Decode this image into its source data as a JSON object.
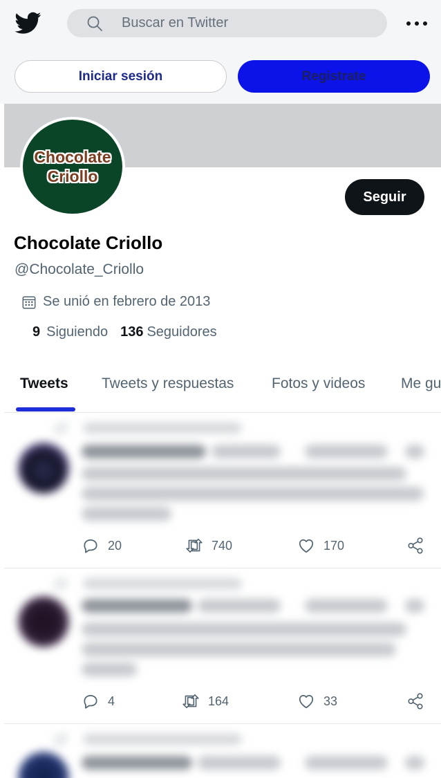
{
  "header": {
    "search_placeholder": "Buscar en Twitter",
    "login_label": "Iniciar sesión",
    "register_label": "Registrate"
  },
  "profile": {
    "avatar_text_line1": "Chocolate",
    "avatar_text_line2": "Criollo",
    "follow_label": "Seguir",
    "name": "Chocolate Criollo",
    "handle": "@Chocolate_Criollo",
    "joined": "Se unió en febrero de 2013",
    "following_count": "9",
    "following_label": "Siguiendo",
    "followers_count": "136",
    "followers_label": "Seguidores"
  },
  "tabs": [
    {
      "label": "Tweets"
    },
    {
      "label": "Tweets y respuestas"
    },
    {
      "label": "Fotos y videos"
    },
    {
      "label": "Me gu"
    }
  ],
  "tweets": [
    {
      "replies": "20",
      "retweets": "740",
      "likes": "170"
    },
    {
      "replies": "4",
      "retweets": "164",
      "likes": "33"
    },
    {}
  ],
  "colors": {
    "brand_blue": "#0c13e8",
    "tab_indicator": "#1d2ed8",
    "avatar_bg": "#0b4527"
  },
  "icons": [
    "twitter-bird-icon",
    "search-icon",
    "more-icon",
    "calendar-icon",
    "reply-icon",
    "retweet-icon",
    "like-icon",
    "share-icon"
  ]
}
